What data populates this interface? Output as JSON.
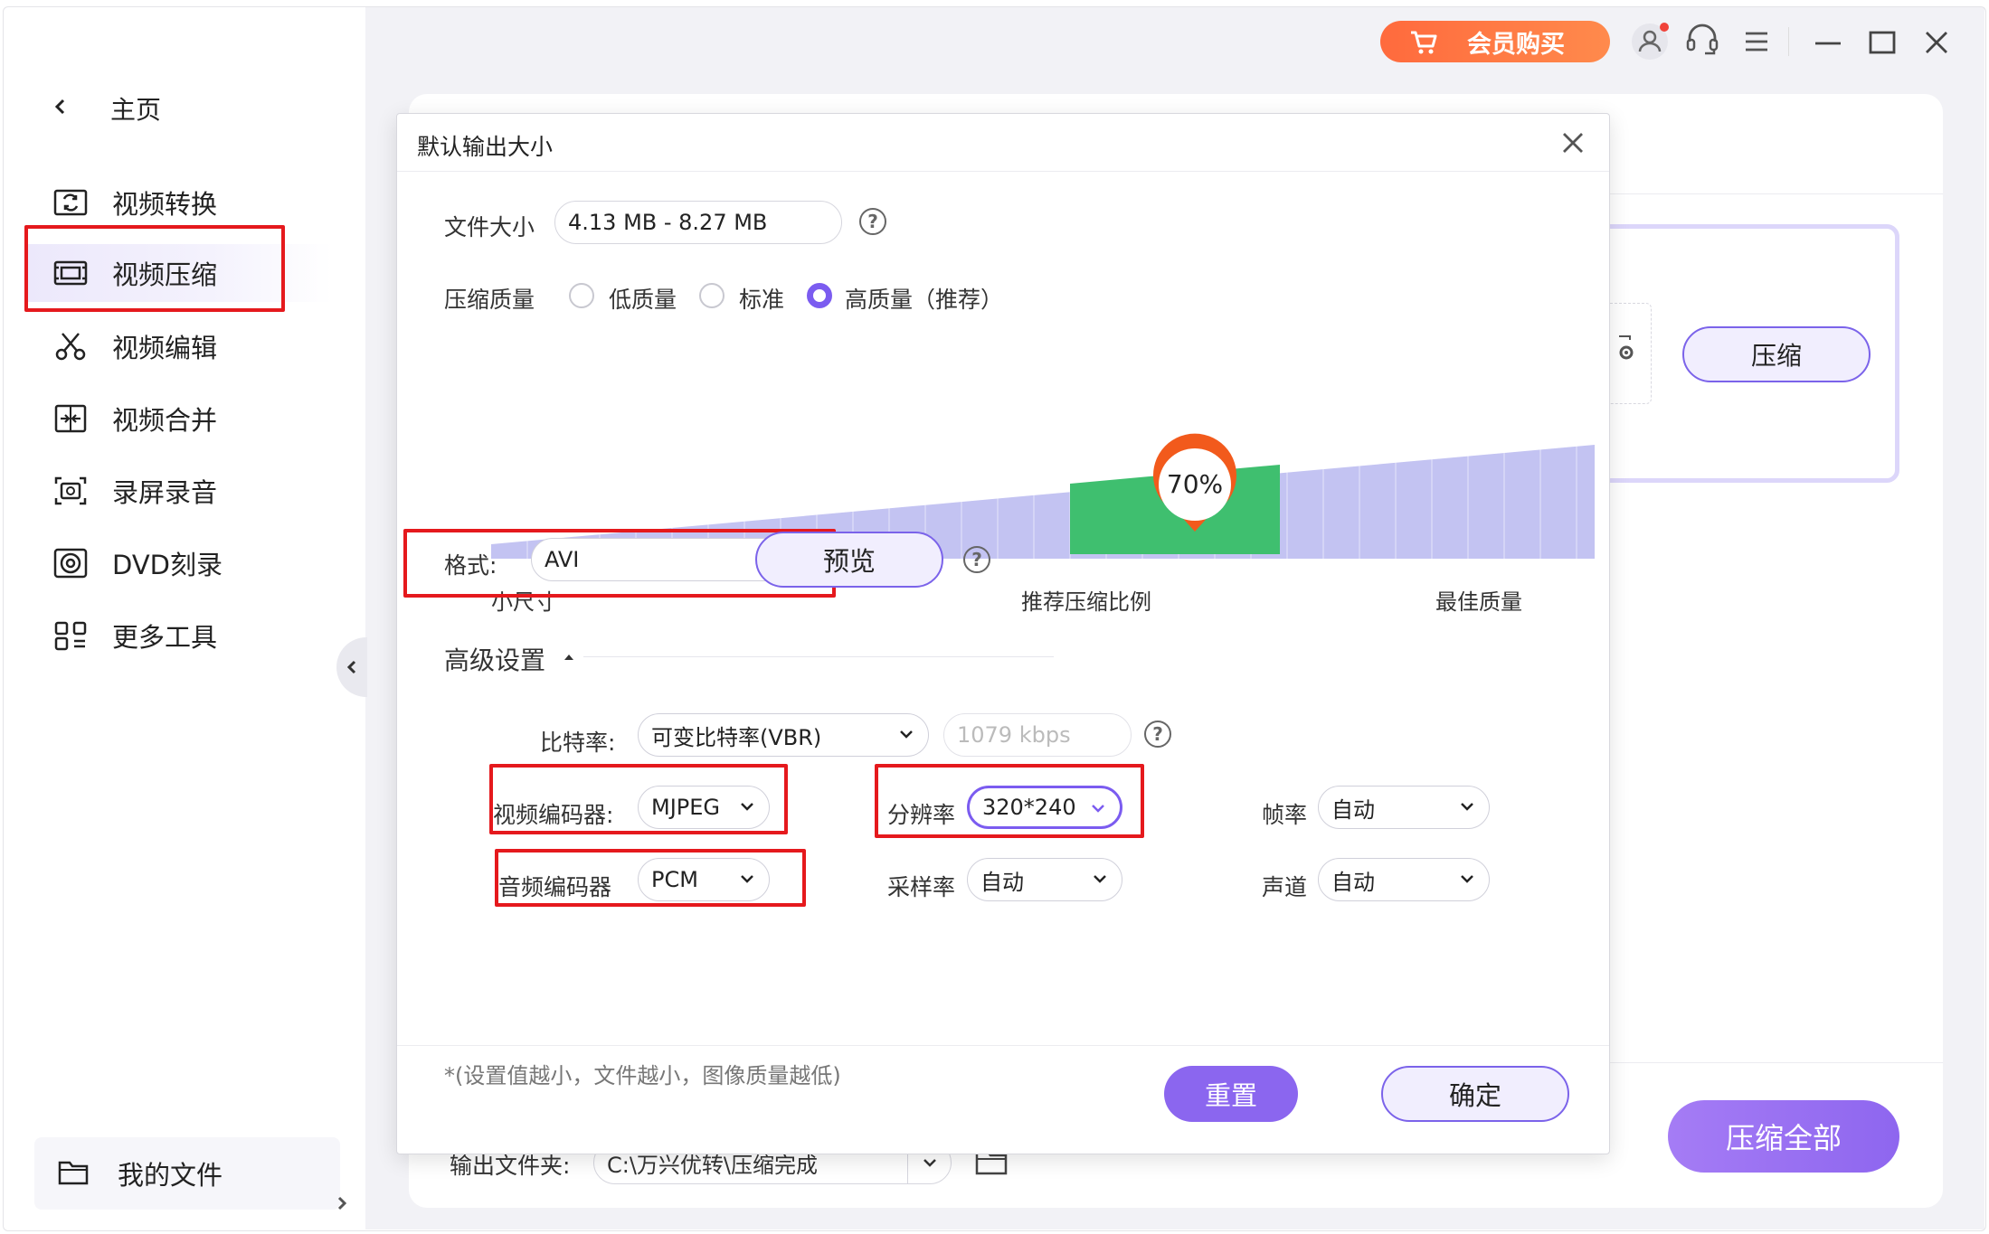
{
  "topbar": {
    "vip_label": "会员购买",
    "colors": {
      "vip_start": "#ff6a3d",
      "vip_end": "#ff8a4c"
    }
  },
  "sidebar": {
    "home_label": "主页",
    "items": [
      {
        "label": "视频转换",
        "icon": "video-convert-icon",
        "active": false
      },
      {
        "label": "视频压缩",
        "icon": "video-compress-icon",
        "active": true
      },
      {
        "label": "视频编辑",
        "icon": "scissors-icon",
        "active": false
      },
      {
        "label": "视频合并",
        "icon": "merge-icon",
        "active": false
      },
      {
        "label": "录屏录音",
        "icon": "screen-record-icon",
        "active": false
      },
      {
        "label": "DVD刻录",
        "icon": "disc-icon",
        "active": false
      },
      {
        "label": "更多工具",
        "icon": "grid-icon",
        "active": false
      }
    ],
    "my_files_label": "我的文件"
  },
  "main": {
    "compress_button": "压缩",
    "compress_all_button": "压缩全部",
    "output_folder_label": "输出文件夹:",
    "output_folder_path": "C:\\万兴优转\\压缩完成"
  },
  "dialog": {
    "title": "默认输出大小",
    "file_size_label": "文件大小",
    "file_size_value": "4.13 MB - 8.27 MB",
    "quality_label": "压缩质量",
    "quality_options": [
      {
        "label": "低质量",
        "selected": false
      },
      {
        "label": "标准",
        "selected": false
      },
      {
        "label": "高质量（推荐）",
        "selected": true
      }
    ],
    "slider": {
      "percent_label": "70%",
      "value": 70,
      "left_label": "小尺寸",
      "middle_label": "推荐压缩比例",
      "right_label": "最佳质量",
      "colors": {
        "track": "#c3c3f2",
        "recommended": "#3fbf6f",
        "marker": "#f25a1c"
      }
    },
    "format_label": "格式:",
    "format_value": "AVI",
    "preview_button": "预览",
    "advanced_title": "高级设置",
    "bitrate_label": "比特率:",
    "bitrate_mode": "可变比特率(VBR)",
    "bitrate_value": "1079 kbps",
    "video_encoder_label": "视频编码器:",
    "video_encoder_value": "MJPEG",
    "resolution_label": "分辨率",
    "resolution_value": "320*240",
    "framerate_label": "帧率",
    "framerate_value": "自动",
    "audio_encoder_label": "音频编码器",
    "audio_encoder_value": "PCM",
    "samplerate_label": "采样率",
    "samplerate_value": "自动",
    "channel_label": "声道",
    "channel_value": "自动",
    "note": "*(设置值越小，文件越小，图像质量越低)",
    "reset_button": "重置",
    "ok_button": "确定",
    "accent_color": "#7b5cf0",
    "highlight_color": "#e5191d"
  }
}
